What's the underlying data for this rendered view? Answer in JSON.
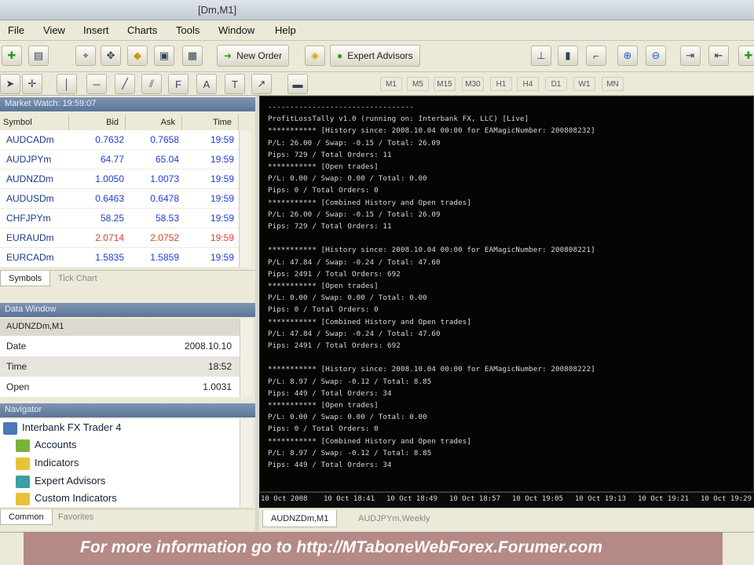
{
  "window": {
    "title": "[Dm,M1]"
  },
  "menu": [
    "File",
    "View",
    "Insert",
    "Charts",
    "Tools",
    "Window",
    "Help"
  ],
  "toolbar": {
    "new_order": "New Order",
    "expert_advisors": "Expert Advisors"
  },
  "timeframes": [
    "M1",
    "M5",
    "M15",
    "M30",
    "H1",
    "H4",
    "D1",
    "W1",
    "MN"
  ],
  "market_watch": {
    "title": "Market Watch: 19:59:07",
    "columns": [
      "Symbol",
      "Bid",
      "Ask",
      "Time"
    ],
    "rows": [
      {
        "symbol": "AUDCADm",
        "bid": "0.7632",
        "ask": "0.7658",
        "time": "19:59"
      },
      {
        "symbol": "AUDJPYm",
        "bid": "64.77",
        "ask": "65.04",
        "time": "19:59"
      },
      {
        "symbol": "AUDNZDm",
        "bid": "1.0050",
        "ask": "1.0073",
        "time": "19:59"
      },
      {
        "symbol": "AUDUSDm",
        "bid": "0.6463",
        "ask": "0.6478",
        "time": "19:59"
      },
      {
        "symbol": "CHFJPYm",
        "bid": "58.25",
        "ask": "58.53",
        "time": "19:59"
      },
      {
        "symbol": "EURAUDm",
        "bid": "2.0714",
        "ask": "2.0752",
        "time": "19:59"
      },
      {
        "symbol": "EURCADm",
        "bid": "1.5835",
        "ask": "1.5859",
        "time": "19:59"
      }
    ],
    "tabs": [
      "Symbols",
      "Tick Chart"
    ]
  },
  "data_window": {
    "title": "Data Window",
    "symbol": "AUDNZDm,M1",
    "rows": [
      {
        "label": "Date",
        "value": "2008.10.10"
      },
      {
        "label": "Time",
        "value": "18:52"
      },
      {
        "label": "Open",
        "value": "1.0031"
      }
    ]
  },
  "navigator": {
    "title": "Navigator",
    "root": "Interbank FX Trader 4",
    "items": [
      "Accounts",
      "Indicators",
      "Expert Advisors",
      "Custom Indicators"
    ],
    "tabs": [
      "Common",
      "Favorites"
    ]
  },
  "terminal_lines": [
    "---------------------------------",
    "ProfitLossTally v1.0 (running on: Interbank FX, LLC) [Live]",
    "*********** [History since: 2008.10.04 00:00 for EAMagicNumber: 200808232]",
    "P/L: 26.00 / Swap: -0.15 / Total: 26.09",
    "Pips: 729 / Total Orders: 11",
    "*********** [Open trades]",
    "P/L: 0.00 / Swap: 0.00 / Total: 0.00",
    "Pips: 0 / Total Orders: 0",
    "*********** [Combined History and Open trades]",
    "P/L: 26.00 / Swap: -0.15 / Total: 26.09",
    "Pips: 729 / Total Orders: 11",
    "",
    "*********** [History since: 2008.10.04 00:00 for EAMagicNumber: 200808221]",
    "P/L: 47.84 / Swap: -0.24 / Total: 47.60",
    "Pips: 2491 / Total Orders: 692",
    "*********** [Open trades]",
    "P/L: 0.00 / Swap: 0.00 / Total: 0.00",
    "Pips: 0 / Total Orders: 0",
    "*********** [Combined History and Open trades]",
    "P/L: 47.84 / Swap: -0.24 / Total: 47.60",
    "Pips: 2491 / Total Orders: 692",
    "",
    "*********** [History since: 2008.10.04 00:00 for EAMagicNumber: 200808222]",
    "P/L: 8.97 / Swap: -0.12 / Total: 8.85",
    "Pips: 449 / Total Orders: 34",
    "*********** [Open trades]",
    "P/L: 0.00 / Swap: 0.00 / Total: 0.00",
    "Pips: 0 / Total Orders: 0",
    "*********** [Combined History and Open trades]",
    "P/L: 8.97 / Swap: -0.12 / Total: 8.85",
    "Pips: 449 / Total Orders: 34"
  ],
  "time_axis": [
    "10 Oct 2008",
    "10 Oct 18:41",
    "10 Oct 18:49",
    "10 Oct 18:57",
    "10 Oct 19:05",
    "10 Oct 19:13",
    "10 Oct 19:21",
    "10 Oct 19:29"
  ],
  "chart_tabs": [
    "AUDNZDm,M1",
    "AUDJPYm,Weekly"
  ],
  "watermark": "For more information go to http://MTaboneWebForex.Forumer.com"
}
